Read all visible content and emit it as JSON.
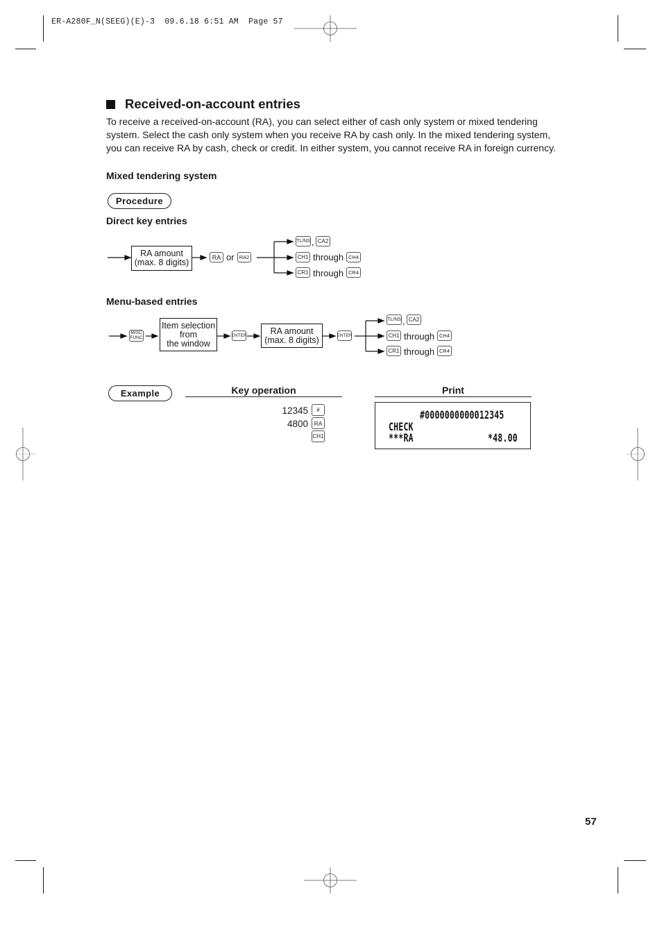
{
  "header": {
    "slug": "ER-A280F_N(SEEG)(E)-3  09.6.18 6:51 AM  Page 57"
  },
  "section": {
    "title": "Received-on-account entries",
    "intro_lines": [
      "To receive a received-on-account (RA), you can select either of cash only system or mixed tendering",
      "system. Select the cash only system when you receive RA by cash only.  In the mixed tendering system,",
      "you can receive RA by cash, check or credit.  In either system, you cannot receive RA in foreign currency."
    ]
  },
  "mixed_tendering": {
    "heading": "Mixed tendering system",
    "procedure_label": "Procedure",
    "direct": {
      "heading": "Direct key entries",
      "amount_box": [
        "RA amount",
        "(max. 8 digits)"
      ],
      "key_ra": "RA",
      "or_label": "or",
      "key_ra2": "RA2",
      "branches": [
        {
          "key1": "TL/NS",
          "sep": ",",
          "key2": "CA2"
        },
        {
          "key1": "CH1",
          "sep": "through",
          "key2": "CH4"
        },
        {
          "key1": "CR1",
          "sep": "through",
          "key2": "CR4"
        }
      ]
    },
    "menu": {
      "heading": "Menu-based entries",
      "key_misc": [
        "MISC",
        "FUNC"
      ],
      "selection_box": [
        "Item selection",
        "from",
        "the window"
      ],
      "key_enter": "ENTER",
      "amount_box": [
        "RA amount",
        "(max. 8 digits)"
      ],
      "branches": [
        {
          "key1": "TL/NS",
          "sep": ",",
          "key2": "CA2"
        },
        {
          "key1": "CH1",
          "sep": "through",
          "key2": "CH4"
        },
        {
          "key1": "CR1",
          "sep": "through",
          "key2": "CR4"
        }
      ]
    }
  },
  "example": {
    "label": "Example",
    "key_operation_heading": "Key operation",
    "print_heading": "Print",
    "steps": [
      {
        "value": "12345",
        "key": "#"
      },
      {
        "value": "4800",
        "key": "RA"
      },
      {
        "value": "",
        "key": "CH1"
      }
    ],
    "receipt": {
      "line1": "#0000000000012345",
      "line2": "CHECK",
      "line3_label": "***RA",
      "line3_amount": "*48.00"
    }
  },
  "footer": {
    "page_number": "57"
  }
}
